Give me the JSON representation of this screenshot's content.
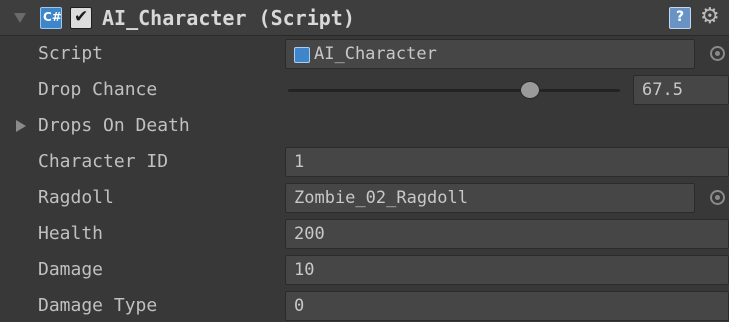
{
  "header": {
    "title": "AI_Character (Script)",
    "enabled": true
  },
  "fields": {
    "script": {
      "label": "Script",
      "value": "AI_Character"
    },
    "drop_chance": {
      "label": "Drop Chance",
      "value": "67.5",
      "slider_fraction": 0.73
    },
    "drops_on_death": {
      "label": "Drops On Death"
    },
    "character_id": {
      "label": "Character ID",
      "value": "1"
    },
    "ragdoll": {
      "label": "Ragdoll",
      "value": "Zombie_02_Ragdoll"
    },
    "health": {
      "label": "Health",
      "value": "200"
    },
    "damage": {
      "label": "Damage",
      "value": "10"
    },
    "damage_type": {
      "label": "Damage Type",
      "value": "0"
    }
  },
  "icons": {
    "header_fold": "triangle-down-icon",
    "script_type": "csharp-script-icon",
    "enabled_toggle": "checkbox-icon",
    "help": "help-book-icon",
    "settings": "gear-icon",
    "object_picker": "object-picker-icon",
    "foldout": "triangle-right-icon"
  },
  "colors": {
    "background": "#383838",
    "field_background": "#464646",
    "script_icon": "#3e86c9",
    "text": "#c2c2c2"
  }
}
